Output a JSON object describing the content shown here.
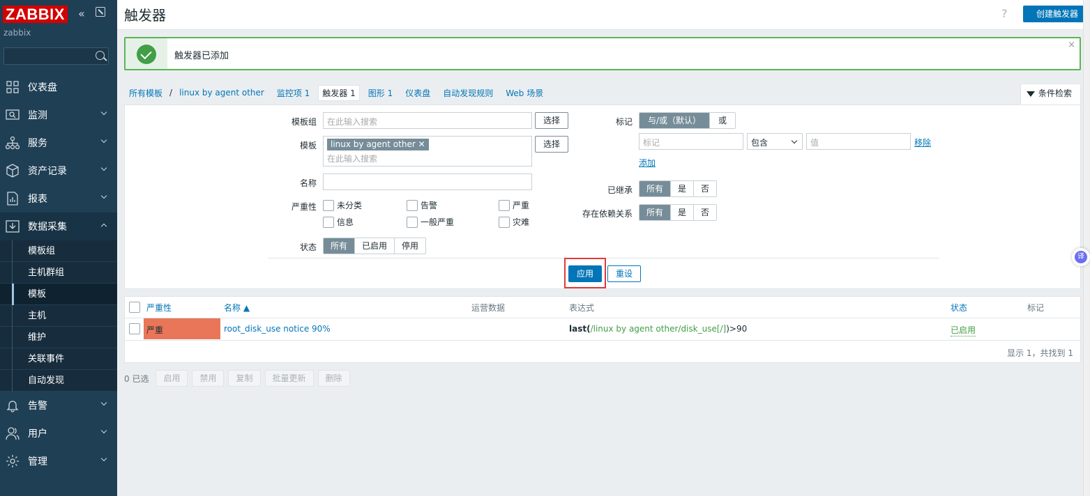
{
  "sidebar": {
    "logo": "ZABBIX",
    "server": "zabbix",
    "search_placeholder": "",
    "items": [
      {
        "label": "仪表盘",
        "icon": "dashboard-icon"
      },
      {
        "label": "监测",
        "icon": "monitoring-icon"
      },
      {
        "label": "服务",
        "icon": "services-icon"
      },
      {
        "label": "资产记录",
        "icon": "inventory-icon"
      },
      {
        "label": "报表",
        "icon": "reports-icon"
      },
      {
        "label": "数据采集",
        "icon": "data-collection-icon"
      },
      {
        "label": "告警",
        "icon": "alerts-icon"
      },
      {
        "label": "用户",
        "icon": "users-icon"
      },
      {
        "label": "管理",
        "icon": "administration-icon"
      }
    ],
    "submenu": [
      "模板组",
      "主机群组",
      "模板",
      "主机",
      "维护",
      "关联事件",
      "自动发现"
    ]
  },
  "header": {
    "title": "触发器",
    "help": "?",
    "create_button": "创建触发器"
  },
  "message": {
    "text": "触发器已添加",
    "close": "×"
  },
  "breadcrumbs": {
    "all_templates": "所有模板",
    "sep": "/",
    "template": "linux by agent other",
    "items": "监控项 1",
    "triggers": "触发器 1",
    "graphs": "图形 1",
    "dashboards": "仪表盘",
    "discovery": "自动发现规则",
    "web": "Web 场景"
  },
  "filter_tab": "条件检索",
  "filter": {
    "template_group_label": "模板组",
    "template_group_placeholder": "在此输入搜索",
    "select": "选择",
    "template_label": "模板",
    "template_chip": "linux by agent other",
    "chip_remove": "✕",
    "template_placeholder": "在此输入搜索",
    "name_label": "名称",
    "name_value": "",
    "severity_label": "严重性",
    "severities": [
      "未分类",
      "告警",
      "严重",
      "信息",
      "一般严重",
      "灾难"
    ],
    "state_label": "状态",
    "state_options": [
      "所有",
      "已启用",
      "停用"
    ],
    "tags_label": "标记",
    "tag_ops": [
      "与/或（默认）",
      "或"
    ],
    "tag_placeholder": "标记",
    "tag_operator": "包含",
    "value_placeholder": "值",
    "remove": "移除",
    "add": "添加",
    "inherited_label": "已继承",
    "inherited_options": [
      "所有",
      "是",
      "否"
    ],
    "deps_label": "存在依赖关系",
    "deps_options": [
      "所有",
      "是",
      "否"
    ],
    "apply": "应用",
    "reset": "重设"
  },
  "table": {
    "headers": {
      "severity": "严重性",
      "name": "名称 ▲",
      "opdata": "运营数据",
      "expression": "表达式",
      "status": "状态",
      "tags": "标记"
    },
    "rows": [
      {
        "severity": "严重",
        "name": "root_disk_use notice 90%",
        "expr_fn": "last",
        "expr_open": "(",
        "expr_key": "/linux by agent other/disk_use[/]",
        "expr_close": ")>90",
        "status": "已启用"
      }
    ],
    "footer": "显示 1，共找到 1"
  },
  "bulk": {
    "selected": "0 已选",
    "buttons": [
      "启用",
      "禁用",
      "复制",
      "批量更新",
      "删除"
    ]
  },
  "translate_badge": "译",
  "colors": {
    "sidebar": "#1f3f55",
    "primary": "#0275b8",
    "success": "#59b556",
    "severity_high": "#e97659"
  }
}
